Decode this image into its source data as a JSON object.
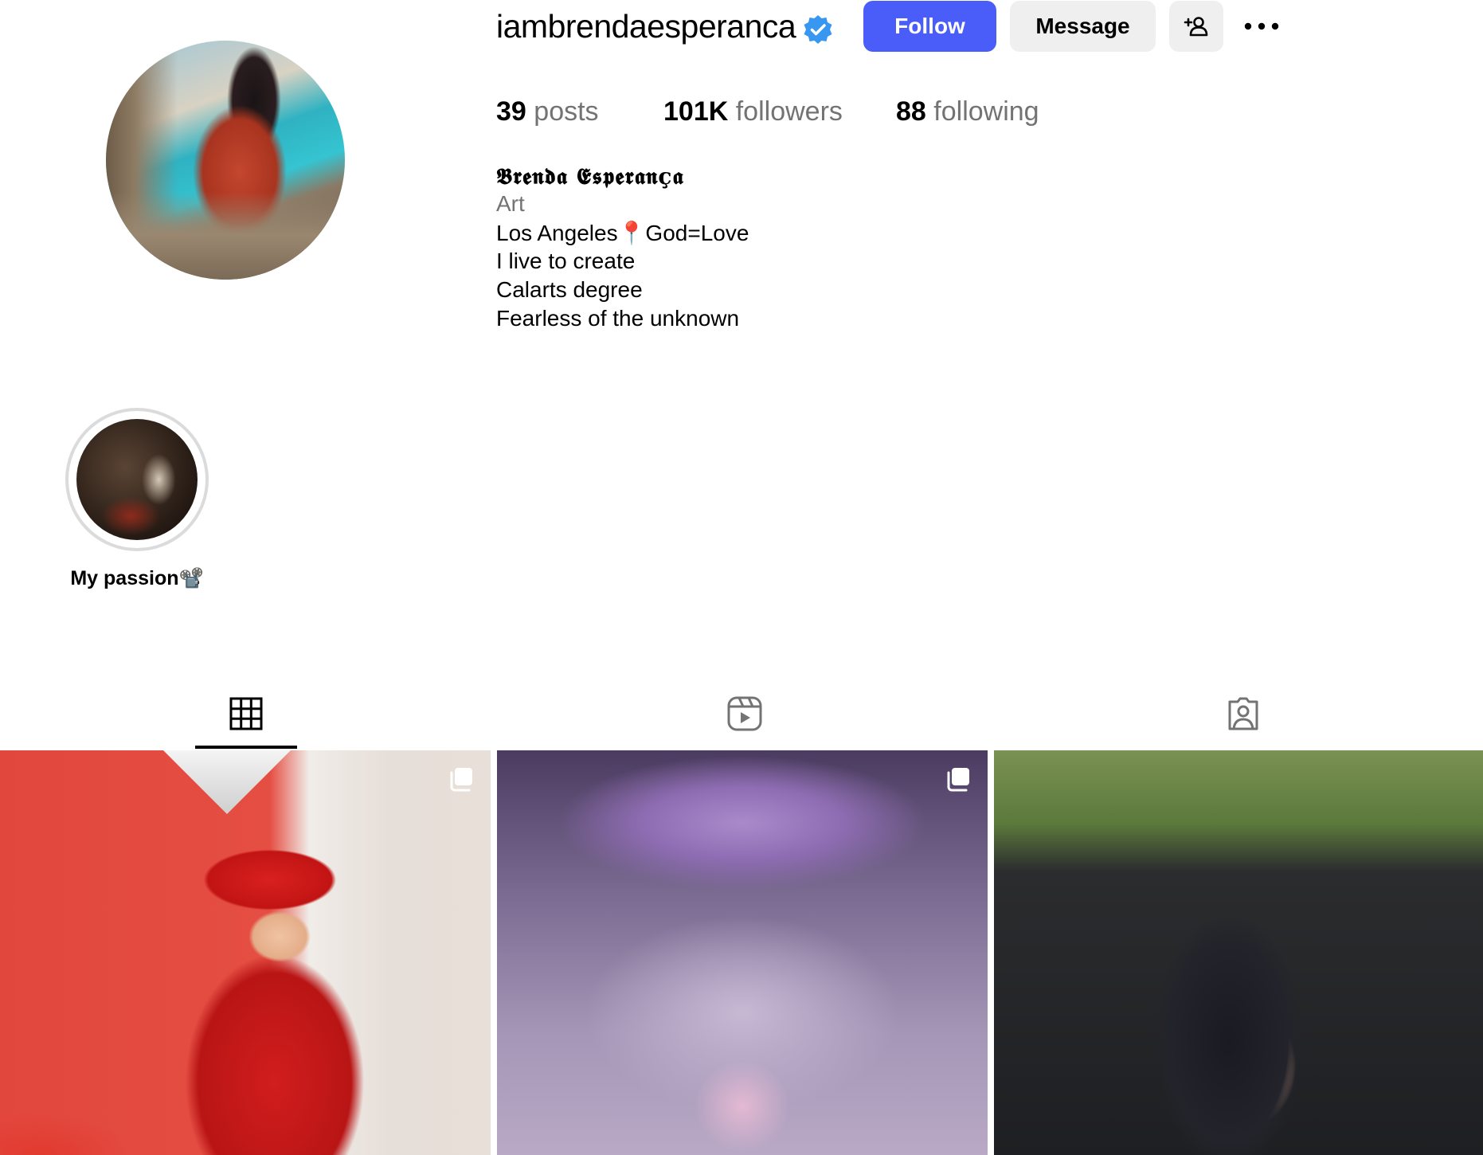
{
  "profile": {
    "username": "iambrendaesperanca",
    "verified_icon": "verified-badge-icon",
    "follow_label": "Follow",
    "message_label": "Message",
    "stats": {
      "posts_count": "39",
      "posts_label": "posts",
      "followers_count": "101K",
      "followers_label": "followers",
      "following_count": "88",
      "following_label": "following"
    },
    "bio": {
      "name": "𝕭𝖗𝖊𝖓𝖉𝖆 𝕰𝖘𝖕𝖊𝖗𝖆𝖓ç𝖆",
      "category": "Art",
      "lines": [
        "Los Angeles📍God=Love",
        "I live to create",
        "Calarts degree",
        "Fearless of the unknown"
      ]
    }
  },
  "highlights": [
    {
      "label": "My passion📽️"
    }
  ],
  "tabs": [
    {
      "icon": "grid-icon",
      "active": true
    },
    {
      "icon": "reels-icon",
      "active": false
    },
    {
      "icon": "tagged-icon",
      "active": false
    }
  ],
  "colors": {
    "accent": "#4a5df9",
    "secondary_button": "#efefef",
    "muted_text": "#737373",
    "verified": "#3897f0"
  }
}
